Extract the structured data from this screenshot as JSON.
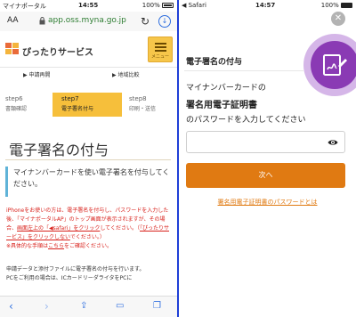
{
  "left": {
    "status": {
      "carrier": "マイナポータル",
      "time": "14:55",
      "battery": "100%"
    },
    "browser": {
      "text_size": "AA",
      "url": "app.oss.myna.go.jp"
    },
    "site": {
      "name": "ぴったりサービス",
      "menu_label": "メニュー"
    },
    "subnav": {
      "item1": "申請再開",
      "item2": "地域比較"
    },
    "steps": [
      {
        "number": "step6",
        "label": "書類確認"
      },
      {
        "number": "step7",
        "label": "電子署名付与"
      },
      {
        "number": "step8",
        "label": "印刷・送信"
      }
    ],
    "page_title": "電子署名の付与",
    "callout": "マイナンバーカードを使い電子署名を付与してください。",
    "warning": {
      "line1": "iPhoneをお使いの方は、電子署名を付与し、パスワードを入力した後、「マイナポータルAP」のトップ画面が表示されますが、その場合、",
      "link1": "画面左上の「◀safari」をクリック",
      "mid": "してください。（",
      "link2": "「ぴったりサービス」をクリックしない",
      "end": "でください。）",
      "detail_prefix": "※具体的な手順は",
      "detail_link": "こちら",
      "detail_suffix": "をご確認ください。"
    },
    "note": {
      "line1": "申請データと添付ファイルに電子署名の付与を行います。",
      "line2": "PCをご利用の場合は、ICカードリーダライタをPCに"
    },
    "toolbar_icons": [
      "back-icon",
      "forward-icon",
      "share-icon",
      "bookmarks-icon",
      "tabs-icon"
    ]
  },
  "right": {
    "status": {
      "back_label": "◀ Safari",
      "time": "14:57",
      "battery": "100%"
    },
    "close_label": "✕",
    "title": "電子署名の付与",
    "prompt_line1": "マイナンバーカードの",
    "prompt_line2": "署名用電子証明書",
    "prompt_line3": "のパスワードを入力してください",
    "password_value": "",
    "next_label": "次へ",
    "forgot_link": "署名用電子証明書のパスワードとは"
  },
  "colors": {
    "accent_orange": "#e07a12",
    "step_active": "#f6bf3b",
    "warning_red": "#d9221c",
    "callout_bar": "#5fb3d8",
    "badge_purple": "#8a3ab4",
    "divider_blue": "#1f3fd6"
  }
}
